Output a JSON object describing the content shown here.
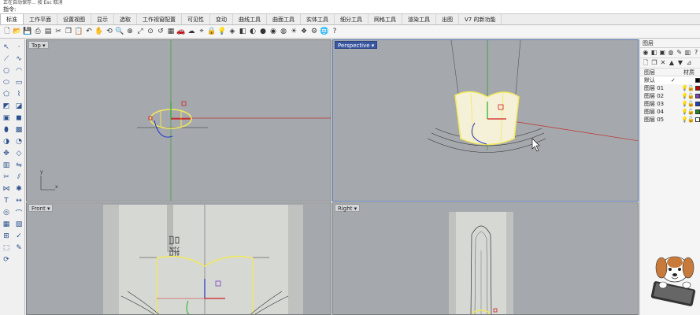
{
  "command": {
    "history": "正在自动保存... 按 Esc 取消",
    "prompt": "指令:"
  },
  "menu_tabs": [
    "标准",
    "工作平面",
    "设置视图",
    "显示",
    "选取",
    "工作视窗配置",
    "可见性",
    "变动",
    "曲线工具",
    "曲面工具",
    "实体工具",
    "细分工具",
    "网格工具",
    "渲染工具",
    "出图",
    "V7 的新功能"
  ],
  "viewports": {
    "top": {
      "label": "Top",
      "axis_x": "x",
      "axis_y": "y"
    },
    "perspective": {
      "label": "Perspective"
    },
    "front": {
      "label": "Front"
    },
    "right": {
      "label": "Right"
    }
  },
  "panel": {
    "title": "图层",
    "header_name": "图层",
    "header_material": "材质",
    "layers": [
      {
        "name": "默认",
        "current": "✓",
        "color": "#000000"
      },
      {
        "name": "图层 01",
        "current": "",
        "color": "#cc0000"
      },
      {
        "name": "图层 02",
        "current": "",
        "color": "#7a3ec0"
      },
      {
        "name": "图层 03",
        "current": "",
        "color": "#1a3fd0"
      },
      {
        "name": "图层 04",
        "current": "",
        "color": "#1a8a1a"
      },
      {
        "name": "图层 05",
        "current": "",
        "color": "#ffffff"
      }
    ]
  },
  "colors": {
    "viewport_bg": "#a5a9ad",
    "curve": "#f2e85a",
    "x_axis": "#c03030",
    "y_axis": "#3a9a3a",
    "active_view": "#3a57a0"
  }
}
